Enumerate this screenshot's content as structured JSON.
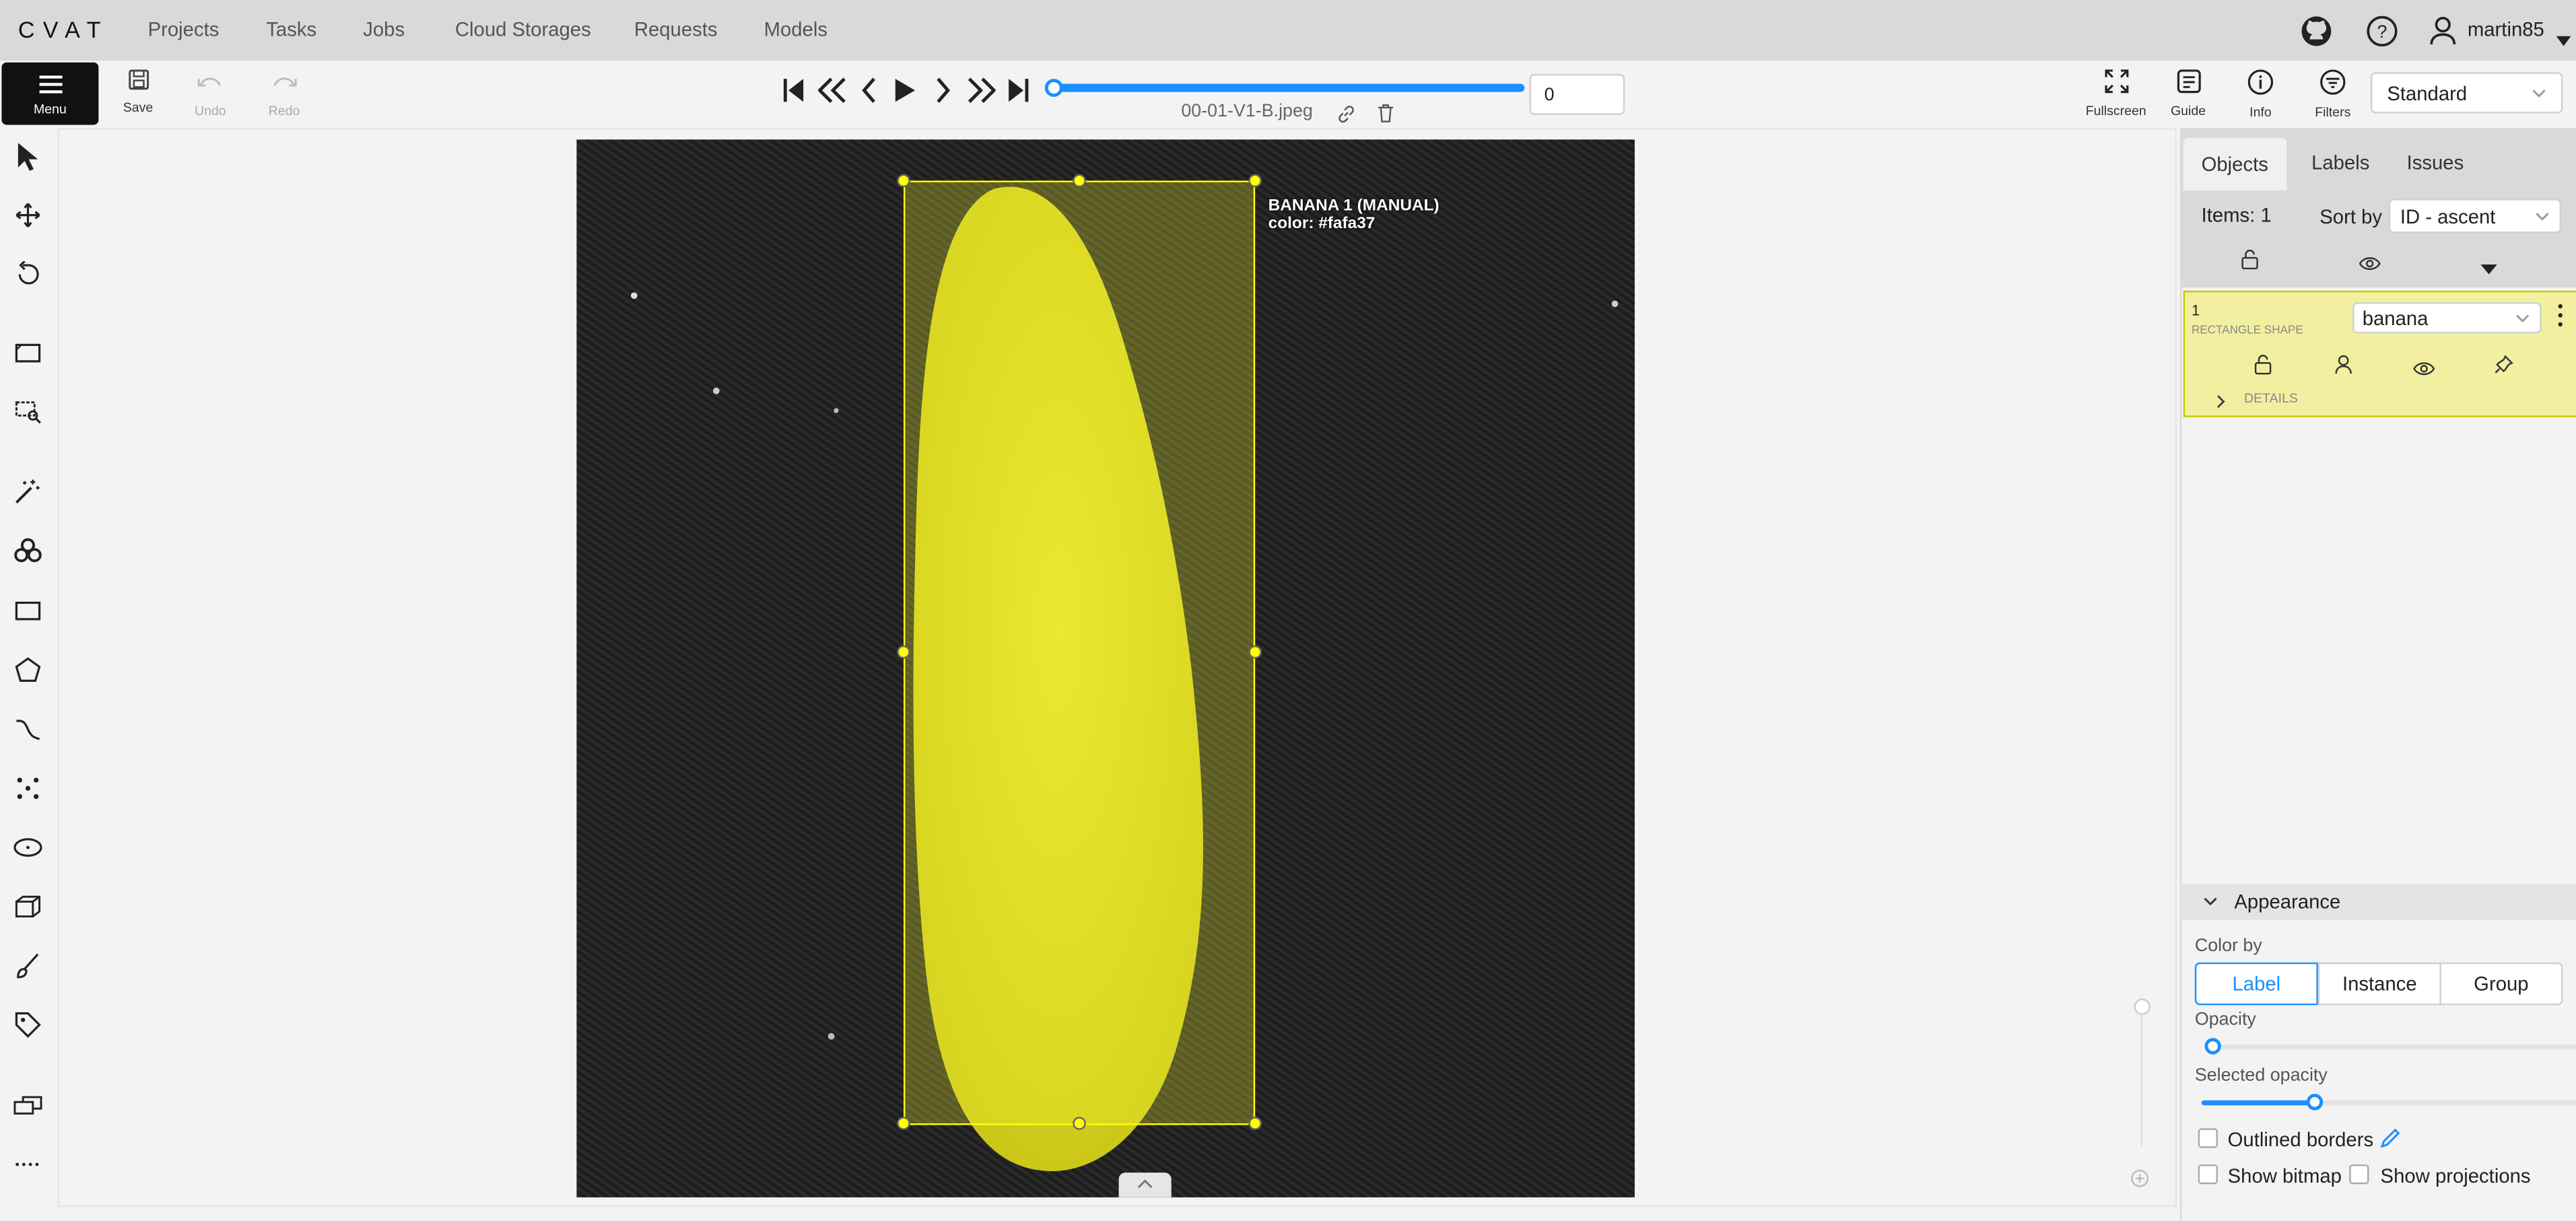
{
  "header": {
    "logo": "CVAT",
    "nav": [
      "Projects",
      "Tasks",
      "Jobs",
      "Cloud Storages",
      "Requests",
      "Models"
    ],
    "user": "martin85"
  },
  "toolbar": {
    "menu": "Menu",
    "save": "Save",
    "undo": "Undo",
    "redo": "Redo",
    "frame": "0",
    "filename": "00-01-V1-B.jpeg",
    "fullscreen": "Fullscreen",
    "guide": "Guide",
    "info": "Info",
    "filters": "Filters",
    "workspace": "Standard",
    "progress": 0
  },
  "canvas": {
    "object_label": "BANANA 1 (MANUAL)",
    "object_color_text": "color: #fafa37",
    "bbox_color": "#ffff00"
  },
  "sidebar": {
    "tabs": [
      "Objects",
      "Labels",
      "Issues"
    ],
    "items_count": "Items: 1",
    "sort_label": "Sort by",
    "sort_value": "ID - ascent",
    "object": {
      "id": "1",
      "type": "RECTANGLE SHAPE",
      "label": "banana",
      "details": "DETAILS",
      "color": "#f2f0a0"
    },
    "appearance": {
      "title": "Appearance",
      "color_by": "Color by",
      "options": [
        "Label",
        "Instance",
        "Group"
      ],
      "opacity_label": "Opacity",
      "opacity": 0.03,
      "selected_opacity_label": "Selected opacity",
      "selected_opacity": 0.3,
      "outlined_borders": "Outlined borders",
      "show_bitmap": "Show bitmap",
      "show_projections": "Show projections"
    }
  },
  "colors": {
    "accent": "#1890ff",
    "dark": "#111111"
  }
}
